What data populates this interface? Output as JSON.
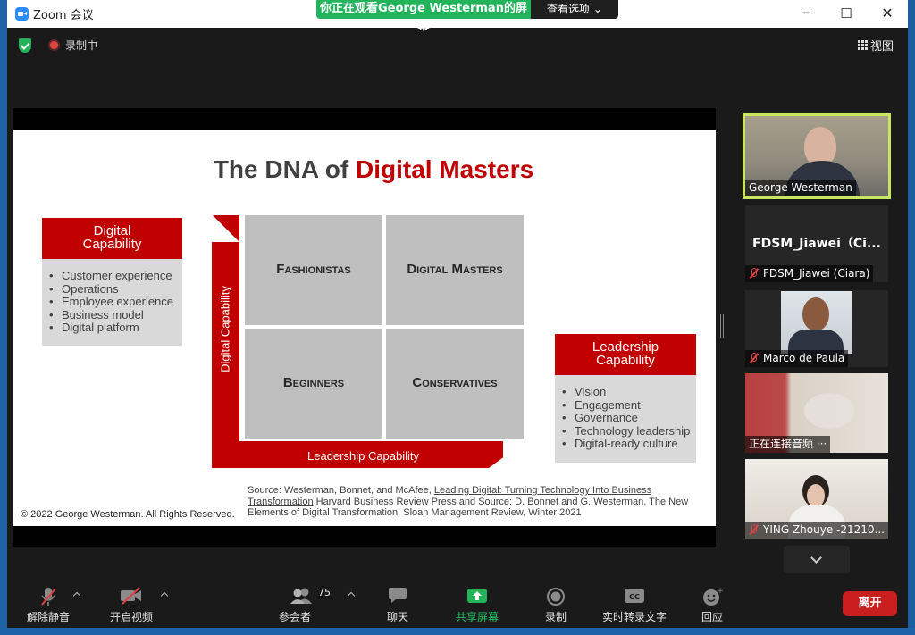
{
  "window": {
    "title": "Zoom 会议",
    "share_banner": "你正在观看George  Westerman的屏幕",
    "view_options": "查看选项",
    "minimize": "─",
    "maximize": "☐",
    "close": "✕"
  },
  "topbar": {
    "recording_label": "录制中",
    "view_label": "视图"
  },
  "slide": {
    "title_plain": "The DNA of ",
    "title_accent": "Digital Masters",
    "digital_capability": {
      "heading": "Digital Capability",
      "items": [
        "Customer experience",
        "Operations",
        "Employee experience",
        "Business model",
        "Digital platform"
      ]
    },
    "leadership_capability": {
      "heading": "Leadership Capability",
      "items": [
        "Vision",
        "Engagement",
        "Governance",
        "Technology leadership",
        "Digital-ready culture"
      ]
    },
    "quadrants": {
      "top_left": "Fashionistas",
      "top_right": "Digital Masters",
      "bottom_left": "Beginners",
      "bottom_right": "Conservatives"
    },
    "axis_vertical": "Digital Capability",
    "axis_horizontal": "Leadership Capability",
    "copyright": "© 2022 George Westerman. All Rights Reserved.",
    "source_prefix": "Source: Westerman, Bonnet, and McAfee,  ",
    "source_book": "Leading Digital: Turning Technology Into Business Transformation",
    "source_suffix": " Harvard Business Review Press and Source: D. Bonnet and G. Westerman, The New Elements of Digital Transformation. Sloan Management Review, Winter 2021"
  },
  "participants": [
    {
      "name": "George Westerman",
      "muted": false
    },
    {
      "name": "FDSM_Jiawei (Ciara)",
      "display": "FDSM_Jiawei（Ci...",
      "muted": true
    },
    {
      "name": "Marco de Paula",
      "muted": true
    },
    {
      "name": "正在连接音频 ···",
      "muted": false
    },
    {
      "name": "YING Zhouye  -21210...",
      "muted": true
    }
  ],
  "toolbar": {
    "unmute": "解除静音",
    "start_video": "开启视频",
    "participants": "参会者",
    "participant_count": "75",
    "chat": "聊天",
    "share_screen": "共享屏幕",
    "record": "录制",
    "live_transcript": "实时转录文字",
    "reactions": "回应",
    "leave": "离开"
  },
  "colors": {
    "accent_red": "#c00000",
    "share_green": "#22b35b",
    "active_speaker": "#c8e660",
    "leave_red": "#c81e1e"
  }
}
